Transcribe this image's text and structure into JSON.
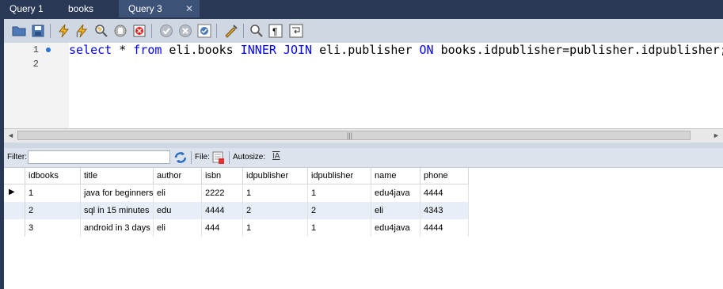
{
  "tabs": [
    {
      "label": "Query 1"
    },
    {
      "label": "books"
    },
    {
      "label": "Query 3",
      "close": "✕"
    }
  ],
  "editor": {
    "line_numbers": [
      "1",
      "2"
    ],
    "sql_tokens": [
      {
        "text": "select",
        "kw": true
      },
      {
        "text": " * ",
        "kw": false
      },
      {
        "text": "from",
        "kw": true
      },
      {
        "text": " eli.books ",
        "kw": false
      },
      {
        "text": "INNER JOIN",
        "kw": true
      },
      {
        "text": " eli.publisher ",
        "kw": false
      },
      {
        "text": "ON",
        "kw": true
      },
      {
        "text": " books.idpublisher=publisher.idpublisher;",
        "kw": false
      }
    ]
  },
  "scrollbar": {
    "left_arrow": "◄",
    "right_arrow": "►",
    "grip": "|||"
  },
  "filterbar": {
    "filter_label": "Filter:",
    "filter_value": "",
    "file_label": "File:",
    "autosize_label": "Autosize:",
    "autosize_icon_text": "IA"
  },
  "results": {
    "columns": [
      "idbooks",
      "title",
      "author",
      "isbn",
      "idpublisher",
      "idpublisher",
      "name",
      "phone"
    ],
    "rows": [
      [
        "1",
        "java for beginners",
        "eli",
        "2222",
        "1",
        "1",
        "edu4java",
        "4444"
      ],
      [
        "2",
        "sql in 15 minutes",
        "edu",
        "4444",
        "2",
        "2",
        "eli",
        "4343"
      ],
      [
        "3",
        "android in 3 days",
        "eli",
        "444",
        "1",
        "1",
        "edu4java",
        "4444"
      ]
    ],
    "current_row_marker": "▶"
  },
  "colors": {
    "window_bg": "#293955",
    "active_tab": "#3d5277",
    "keyword": "#0000ff",
    "toolbar": "#cfd7e2",
    "alt_row": "#e8eef7"
  },
  "icons": [
    "open-file-icon",
    "save-icon",
    "execute-icon",
    "execute-current-icon",
    "explain-icon",
    "stop-icon",
    "stop-on-error-icon",
    "commit-icon",
    "rollback-icon",
    "autocommit-icon",
    "beautify-icon",
    "find-icon",
    "invisible-chars-icon",
    "word-wrap-icon"
  ]
}
